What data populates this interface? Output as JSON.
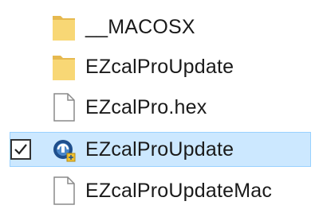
{
  "files": [
    {
      "name": "__MACOSX",
      "type": "folder"
    },
    {
      "name": "EZcalProUpdate",
      "type": "folder"
    },
    {
      "name": "EZcalPro.hex",
      "type": "file"
    },
    {
      "name": "EZcalProUpdate",
      "type": "application",
      "selected": true,
      "checked": true
    },
    {
      "name": "EZcalProUpdateMac",
      "type": "file"
    }
  ],
  "colors": {
    "folder": "#f8d775",
    "folder_dark": "#e6b94f",
    "selection_bg": "#cce8ff",
    "selection_border": "#99d1ff"
  }
}
